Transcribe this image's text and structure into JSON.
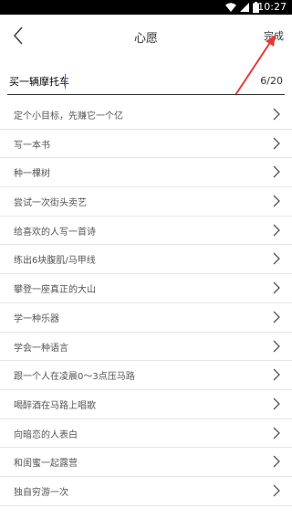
{
  "status_bar": {
    "time": "10:27",
    "bg_color": "#000000",
    "icons": [
      "wifi-icon",
      "cellular-icon",
      "battery-icon"
    ]
  },
  "header": {
    "title": "心愿",
    "back_icon": "chevron-left-icon",
    "done_label": "完成"
  },
  "annotation": {
    "color": "#e53935",
    "icon": "arrow-up-right-icon"
  },
  "input": {
    "value": "买一辆摩托车",
    "counter": "6/20",
    "caret_color": "#1a73e8"
  },
  "suggestions": [
    {
      "label": "定个小目标，先赚它一个亿"
    },
    {
      "label": "写一本书"
    },
    {
      "label": "种一棵树"
    },
    {
      "label": "尝试一次街头卖艺"
    },
    {
      "label": "给喜欢的人写一首诗"
    },
    {
      "label": "练出6块腹肌/马甲线"
    },
    {
      "label": "攀登一座真正的大山"
    },
    {
      "label": "学一种乐器"
    },
    {
      "label": "学会一种语言"
    },
    {
      "label": "跟一个人在凌晨0～3点压马路"
    },
    {
      "label": "喝醉酒在马路上唱歌"
    },
    {
      "label": "向暗恋的人表白"
    },
    {
      "label": "和闺蜜一起露营"
    },
    {
      "label": "独自穷游一次"
    }
  ]
}
